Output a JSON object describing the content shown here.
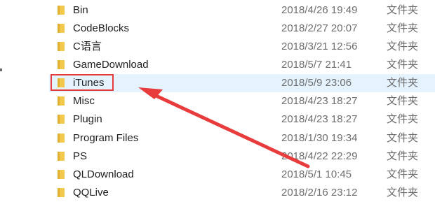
{
  "file_list": {
    "rows": [
      {
        "name": "Bin",
        "date": "2018/4/26 19:49",
        "type": "文件夹"
      },
      {
        "name": "CodeBlocks",
        "date": "2018/2/27 20:07",
        "type": "文件夹"
      },
      {
        "name": "C语言",
        "date": "2018/3/21 12:56",
        "type": "文件夹"
      },
      {
        "name": "GameDownload",
        "date": "2018/5/7 21:41",
        "type": "文件夹"
      },
      {
        "name": "iTunes",
        "date": "2018/5/9 23:06",
        "type": "文件夹",
        "selected": true
      },
      {
        "name": "Misc",
        "date": "2018/4/23 18:27",
        "type": "文件夹"
      },
      {
        "name": "Plugin",
        "date": "2018/4/23 18:27",
        "type": "文件夹"
      },
      {
        "name": "Program Files",
        "date": "2018/1/30 19:34",
        "type": "文件夹"
      },
      {
        "name": "PS",
        "date": "2018/4/22 22:29",
        "type": "文件夹"
      },
      {
        "name": "QLDownload",
        "date": "2018/5/1 10:45",
        "type": "文件夹"
      },
      {
        "name": "QQLive",
        "date": "2018/2/16 23:12",
        "type": "文件夹"
      }
    ]
  },
  "icons": {
    "folder": "folder-icon"
  },
  "colors": {
    "selection_bg": "#e5f3ff",
    "annotation_red": "#e83b3b",
    "folder_yellow": "#f5c542"
  }
}
